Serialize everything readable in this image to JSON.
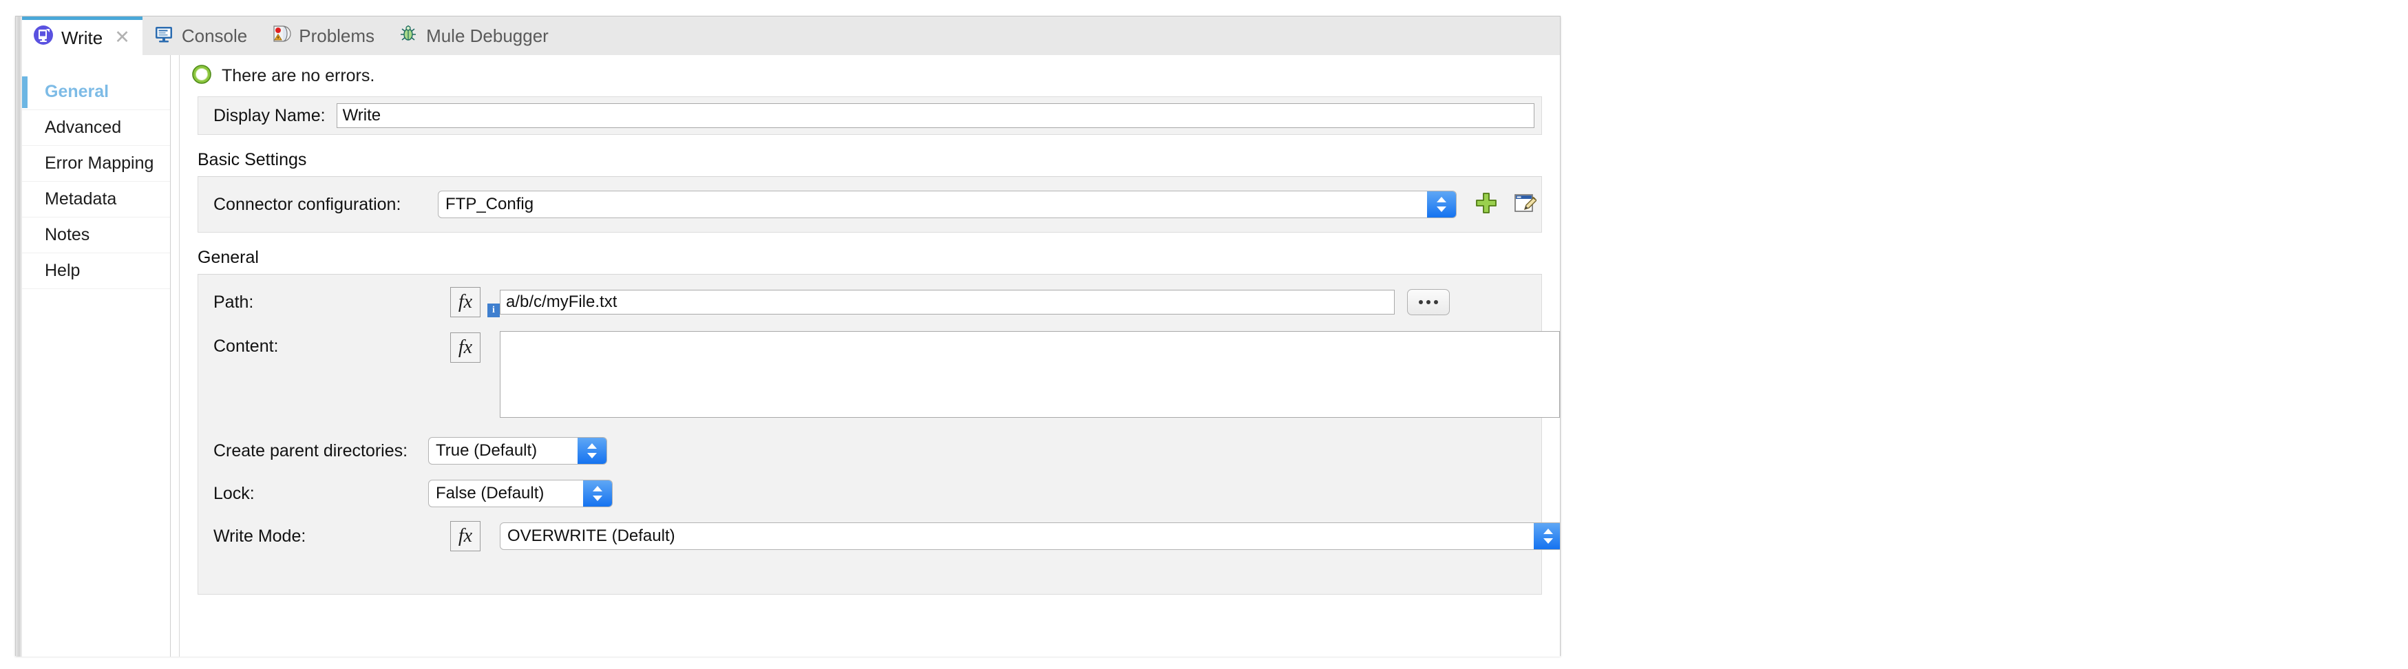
{
  "window": {
    "tabs": [
      {
        "label": "Write",
        "icon": "mule-write-icon",
        "active": true,
        "closable": true,
        "close_glyph": "✕"
      },
      {
        "label": "Console",
        "icon": "console-icon",
        "active": false,
        "closable": false
      },
      {
        "label": "Problems",
        "icon": "problems-icon",
        "active": false,
        "closable": false
      },
      {
        "label": "Mule Debugger",
        "icon": "bug-icon",
        "active": false,
        "closable": false
      }
    ]
  },
  "sidebar": {
    "items": [
      {
        "label": "General",
        "active": true
      },
      {
        "label": "Advanced",
        "active": false
      },
      {
        "label": "Error Mapping",
        "active": false
      },
      {
        "label": "Metadata",
        "active": false
      },
      {
        "label": "Notes",
        "active": false
      },
      {
        "label": "Help",
        "active": false
      }
    ]
  },
  "status": {
    "icon": "success-check-icon",
    "text": "There are no errors.",
    "color": "#66b320"
  },
  "form": {
    "display_name": {
      "label": "Display Name:",
      "value": "Write",
      "placeholder": ""
    },
    "sections": {
      "basic_settings": "Basic Settings",
      "general": "General"
    },
    "connector_configuration": {
      "label": "Connector configuration:",
      "value": "FTP_Config",
      "add_icon": "add-plus-icon",
      "edit_icon": "edit-pencil-icon"
    },
    "path": {
      "label": "Path:",
      "value": "a/b/c/myFile.txt",
      "placeholder": "",
      "fx_label": "fx",
      "info_badge": "i",
      "browse_label": "..."
    },
    "content": {
      "label": "Content:",
      "value": "",
      "placeholder": "",
      "fx_label": "fx"
    },
    "create_parent_directories": {
      "label": "Create parent directories:",
      "value": "True (Default)"
    },
    "lock": {
      "label": "Lock:",
      "value": "False (Default)"
    },
    "write_mode": {
      "label": "Write Mode:",
      "value": "OVERWRITE (Default)",
      "fx_label": "fx"
    }
  },
  "colors": {
    "active_tab_accent": "#4aa8d8",
    "nav_active": "#7dbbe6",
    "stepper_blue": "#1573f0",
    "success_green": "#66b320",
    "info_blue": "#3f7fcf"
  }
}
